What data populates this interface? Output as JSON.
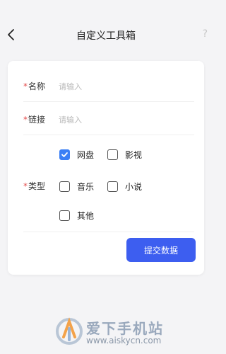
{
  "header": {
    "title": "自定义工具箱",
    "help_glyph": "?"
  },
  "form": {
    "required_mark": "*",
    "name": {
      "label": "名称",
      "placeholder": "请输入"
    },
    "link": {
      "label": "链接",
      "placeholder": "请输入"
    },
    "type": {
      "label": "类型",
      "options": [
        {
          "label": "网盘",
          "checked": true
        },
        {
          "label": "影视",
          "checked": false
        },
        {
          "label": "音乐",
          "checked": false
        },
        {
          "label": "小说",
          "checked": false
        },
        {
          "label": "其他",
          "checked": false
        }
      ]
    },
    "submit_label": "提交数据"
  },
  "watermark": {
    "text": "爱下手机站",
    "url": "www.aiskycn.com"
  },
  "colors": {
    "accent": "#3d5ef0",
    "checkbox_checked": "#3b7ff5",
    "required": "#e34d4d"
  },
  "icons": {
    "back": "chevron-left-icon",
    "help": "question-icon",
    "check": "check-icon",
    "logo": "aixia-logo-icon"
  }
}
